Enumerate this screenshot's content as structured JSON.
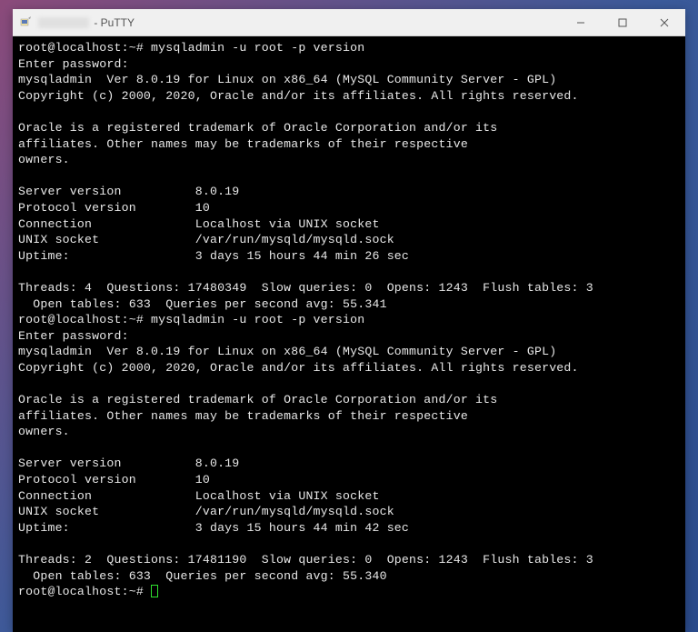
{
  "window": {
    "title_suffix": " - PuTTY"
  },
  "terminal": {
    "block1": {
      "prompt_line": "root@localhost:~# mysqladmin -u root -p version",
      "enter_pw": "Enter password:",
      "ver_line": "mysqladmin  Ver 8.0.19 for Linux on x86_64 (MySQL Community Server - GPL)",
      "copyright": "Copyright (c) 2000, 2020, Oracle and/or its affiliates. All rights reserved.",
      "trademark1": "Oracle is a registered trademark of Oracle Corporation and/or its",
      "trademark2": "affiliates. Other names may be trademarks of their respective",
      "trademark3": "owners.",
      "server_version": "Server version          8.0.19",
      "protocol": "Protocol version        10",
      "connection": "Connection              Localhost via UNIX socket",
      "unix_socket": "UNIX socket             /var/run/mysqld/mysqld.sock",
      "uptime": "Uptime:                 3 days 15 hours 44 min 26 sec",
      "stats1": "Threads: 4  Questions: 17480349  Slow queries: 0  Opens: 1243  Flush tables: 3",
      "stats2": "  Open tables: 633  Queries per second avg: 55.341"
    },
    "block2": {
      "prompt_line": "root@localhost:~# mysqladmin -u root -p version",
      "enter_pw": "Enter password:",
      "ver_line": "mysqladmin  Ver 8.0.19 for Linux on x86_64 (MySQL Community Server - GPL)",
      "copyright": "Copyright (c) 2000, 2020, Oracle and/or its affiliates. All rights reserved.",
      "trademark1": "Oracle is a registered trademark of Oracle Corporation and/or its",
      "trademark2": "affiliates. Other names may be trademarks of their respective",
      "trademark3": "owners.",
      "server_version": "Server version          8.0.19",
      "protocol": "Protocol version        10",
      "connection": "Connection              Localhost via UNIX socket",
      "unix_socket": "UNIX socket             /var/run/mysqld/mysqld.sock",
      "uptime": "Uptime:                 3 days 15 hours 44 min 42 sec",
      "stats1": "Threads: 2  Questions: 17481190  Slow queries: 0  Opens: 1243  Flush tables: 3",
      "stats2": "  Open tables: 633  Queries per second avg: 55.340"
    },
    "final_prompt": "root@localhost:~# "
  }
}
